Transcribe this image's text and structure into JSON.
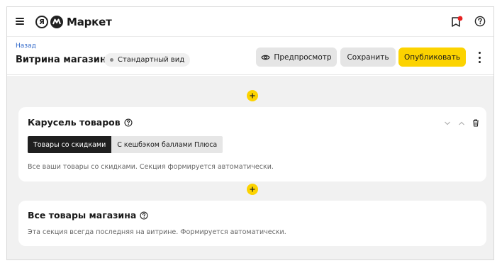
{
  "topbar": {
    "logo_letter": "Я",
    "logo_text": "Маркет",
    "notification_color": "#e62222"
  },
  "header": {
    "back_label": "Назад",
    "title": "Витрина магазина",
    "view_badge": "Стандартный вид",
    "preview_label": "Предпросмотр",
    "save_label": "Сохранить",
    "publish_label": "Опубликовать"
  },
  "sections": [
    {
      "title": "Карусель товаров",
      "tabs": [
        {
          "label": "Товары со скидками",
          "active": true
        },
        {
          "label": "С кешбэком баллами Плюса",
          "active": false
        }
      ],
      "description": "Все ваши товары со скидками. Секция формируется автоматически."
    },
    {
      "title": "Все товары магазина",
      "description": "Эта секция всегда последняя на витрине. Формируется автоматически."
    }
  ],
  "colors": {
    "accent": "#fcd300",
    "link": "#2f67c9",
    "canvas_bg": "#f1f1f1"
  },
  "icons": [
    "menu-icon",
    "market-logo-icon",
    "notification-icon",
    "help-icon",
    "eye-icon",
    "more-vertical-icon",
    "plus-icon",
    "chevron-down-icon",
    "chevron-up-icon",
    "trash-icon"
  ]
}
